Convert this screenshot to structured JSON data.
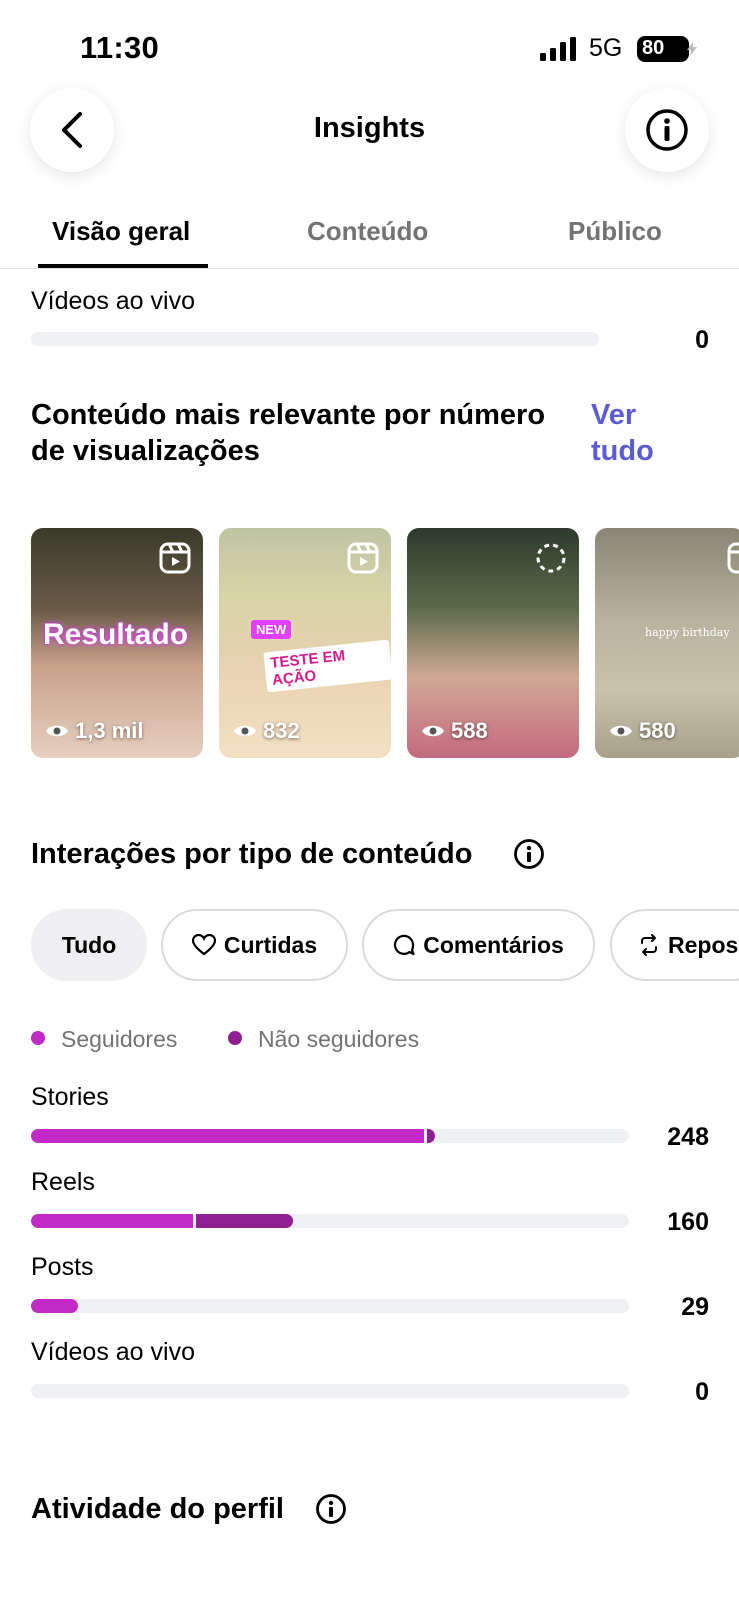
{
  "status_bar": {
    "time": "11:30",
    "network": "5G",
    "battery": "80"
  },
  "header": {
    "title": "Insights"
  },
  "tabs": [
    {
      "label": "Visão geral",
      "active": true
    },
    {
      "label": "Conteúdo",
      "active": false
    },
    {
      "label": "Público",
      "active": false
    }
  ],
  "live_top": {
    "label": "Vídeos ao vivo",
    "value": "0"
  },
  "top_content": {
    "title": "Conteúdo mais relevante por número de visualizações",
    "see_all": "Ver tudo",
    "items": [
      {
        "views": "1,3 mil",
        "type_icon": "reels-icon",
        "overlay_text": "Resultado"
      },
      {
        "views": "832",
        "type_icon": "reels-icon",
        "overlay_text": "TESTE EM AÇÃO",
        "badge": "NEW"
      },
      {
        "views": "588",
        "type_icon": "story-icon"
      },
      {
        "views": "580",
        "type_icon": "reels-icon",
        "overlay_text": "happy birthday"
      }
    ]
  },
  "interactions": {
    "title": "Interações por tipo de conteúdo",
    "filters": [
      {
        "label": "Tudo",
        "icon": "",
        "selected": true
      },
      {
        "label": "Curtidas",
        "icon": "heart-icon",
        "selected": false
      },
      {
        "label": "Comentários",
        "icon": "comment-icon",
        "selected": false
      },
      {
        "label": "Repos",
        "icon": "repost-icon",
        "selected": false
      }
    ],
    "legend": [
      {
        "label": "Seguidores",
        "color": "#c12ac6"
      },
      {
        "label": "Não seguidores",
        "color": "#8f1f91"
      }
    ],
    "rows": [
      {
        "label": "Stories",
        "value": "248",
        "followers": 243,
        "non_followers": 5
      },
      {
        "label": "Reels",
        "value": "160",
        "followers": 100,
        "non_followers": 60
      },
      {
        "label": "Posts",
        "value": "29",
        "followers": 29,
        "non_followers": 0
      },
      {
        "label": "Vídeos ao vivo",
        "value": "0",
        "followers": 0,
        "non_followers": 0
      }
    ],
    "max": 370
  },
  "profile_activity": {
    "title": "Atividade do perfil"
  }
}
